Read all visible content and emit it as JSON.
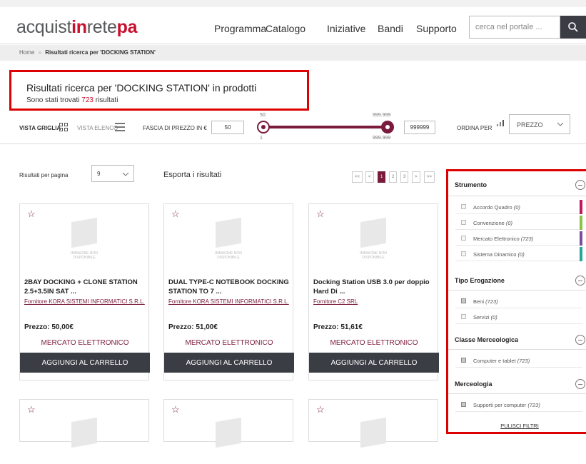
{
  "header": {
    "logo": {
      "part1": "acquist",
      "part2": "in",
      "part3": "rete",
      "part4": "pa"
    },
    "nav": [
      "Programma",
      "Catalogo",
      "Iniziative",
      "Bandi",
      "Supporto"
    ],
    "search_placeholder": "cerca nel portale ...",
    "search_icon": "search-icon"
  },
  "breadcrumb": {
    "home": "Home",
    "sep": "»",
    "current": "Risultati ricerca per 'DOCKING STATION'"
  },
  "results": {
    "title": "Risultati ricerca per 'DOCKING STATION' in prodotti",
    "count_prefix": "Sono stati trovati",
    "count": "723",
    "count_suffix": "risultati"
  },
  "controls": {
    "grid_label": "VISTA GRIGLIA",
    "list_label": "VISTA ELENCO",
    "price_label": "FASCIA DI PREZZO IN €",
    "price_min": "50",
    "price_max": "999999",
    "slider_top_left": "50",
    "slider_bottom_left": "1",
    "slider_top_right": "999.999",
    "slider_bottom_right": "999.999",
    "sort_label": "ORDINA PER",
    "sort_value": "PREZZO"
  },
  "listing": {
    "per_page_label": "Risultati per pagina",
    "per_page_value": "9",
    "export_label": "Esporta i risultati",
    "pagination": [
      "<<",
      "<",
      "1",
      "2",
      "3",
      ">",
      ">>"
    ],
    "active_page": "1"
  },
  "no_image_text": "IMMAGINE NON DISPONIBILE",
  "products": [
    {
      "name": "2BAY DOCKING + CLONE STATION 2.5+3.5IN SAT ...",
      "supplier": "Fornitore KORA SISTEMI INFORMATICI S.R.L.",
      "price": "Prezzo: 50,00€",
      "type": "MERCATO ELETTRONICO",
      "button": "AGGIUNGI AL CARRELLO"
    },
    {
      "name": "DUAL TYPE-C NOTEBOOK DOCKING STATION TO 7 ...",
      "supplier": "Fornitore KORA SISTEMI INFORMATICI S.R.L.",
      "price": "Prezzo: 51,00€",
      "type": "MERCATO ELETTRONICO",
      "button": "AGGIUNGI AL CARRELLO"
    },
    {
      "name": "Docking Station USB 3.0 per doppio Hard Di ...",
      "supplier": "Fornitore C2 SRL",
      "price": "Prezzo: 51,61€",
      "type": "MERCATO ELETTRONICO",
      "button": "AGGIUNGI AL CARRELLO"
    }
  ],
  "filters": {
    "groups": [
      {
        "title": "Strumento",
        "items": [
          {
            "label": "Accordo Quadro",
            "count": "(0)",
            "checked": false,
            "color": "#c2185b"
          },
          {
            "label": "Convenzione",
            "count": "(0)",
            "checked": false,
            "color": "#8bc34a"
          },
          {
            "label": "Mercato Elettronico",
            "count": "(723)",
            "checked": false,
            "color": "#7b4d9e"
          },
          {
            "label": "Sistema Dinamico",
            "count": "(0)",
            "checked": false,
            "color": "#26a69a"
          }
        ]
      },
      {
        "title": "Tipo Erogazione",
        "items": [
          {
            "label": "Beni",
            "count": "(723)",
            "checked": true
          },
          {
            "label": "Servizi",
            "count": "(0)",
            "checked": false
          }
        ]
      },
      {
        "title": "Classe Merceologica",
        "items": [
          {
            "label": "Computer e tablet",
            "count": "(723)",
            "checked": true
          }
        ]
      },
      {
        "title": "Merceologia",
        "items": [
          {
            "label": "Supporti per computer",
            "count": "(723)",
            "checked": true
          }
        ]
      }
    ],
    "clear_label": "PULISCI FILTRI"
  },
  "colors": {
    "brand": "#7a1b3d",
    "accent": "#c8102e",
    "highlight": "#dd0000",
    "button": "#3a3d44"
  }
}
